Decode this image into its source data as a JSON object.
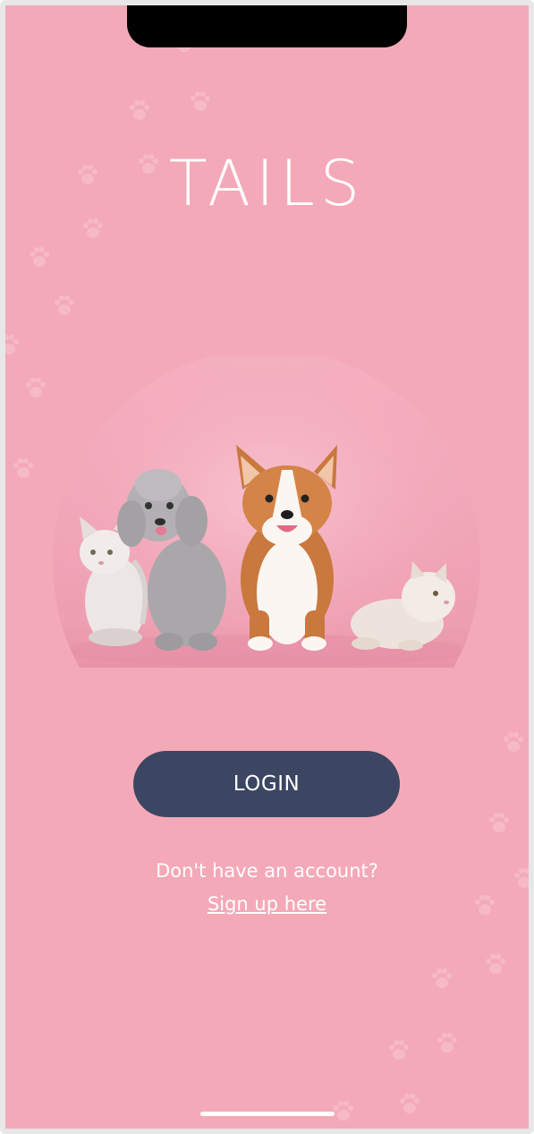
{
  "app": {
    "title": "TAILS"
  },
  "hero": {
    "image_alt": "cats-and-dogs-illustration"
  },
  "actions": {
    "login_label": "LOGIN",
    "account_prompt": "Don't have an account?",
    "signup_label": "Sign up here"
  },
  "colors": {
    "background": "#f4a9b8",
    "button": "#3c4663",
    "text": "#ffffff"
  }
}
